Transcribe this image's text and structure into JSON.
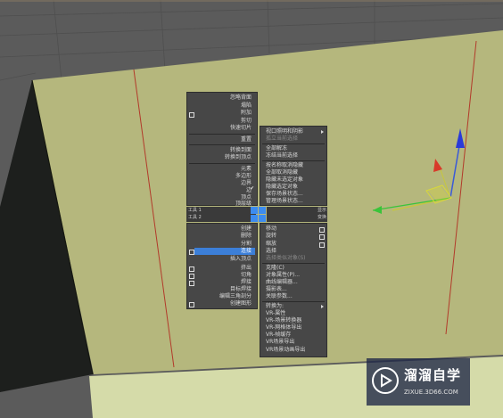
{
  "quad_left_top": [
    {
      "label": "忽略背面"
    },
    {
      "label": "塌陷"
    },
    {
      "label": "附加"
    },
    {
      "label": "剪切"
    },
    {
      "label": "快速切片"
    },
    {
      "label": "重置"
    },
    {
      "label": "转换到面"
    },
    {
      "label": "转换到顶点"
    },
    {
      "label": "元素"
    },
    {
      "label": "多边形"
    },
    {
      "label": "边界"
    },
    {
      "label": "边"
    },
    {
      "label": "顶点"
    },
    {
      "label": "顶层级"
    }
  ],
  "quad_right_top": [
    {
      "label": "视口照明和阴影"
    },
    {
      "label": "孤立当前选择"
    },
    {
      "label": "全部解冻"
    },
    {
      "label": "冻结当前选择"
    },
    {
      "label": "按名称取消隐藏"
    },
    {
      "label": "全部取消隐藏"
    },
    {
      "label": "隐藏未选定对象"
    },
    {
      "label": "隐藏选定对象"
    },
    {
      "label": "保存场景状态..."
    },
    {
      "label": "管理场景状态..."
    }
  ],
  "quad_left_bottom": [
    {
      "label": "创建"
    },
    {
      "label": "删除"
    },
    {
      "label": "分割"
    },
    {
      "label": "连接"
    },
    {
      "label": "插入顶点"
    },
    {
      "label": "挤出"
    },
    {
      "label": "切角"
    },
    {
      "label": "焊接"
    },
    {
      "label": "目标焊接"
    },
    {
      "label": "编辑三角剖分"
    },
    {
      "label": "创建图形"
    }
  ],
  "quad_right_bottom": [
    {
      "label": "移动"
    },
    {
      "label": "旋转"
    },
    {
      "label": "缩放"
    },
    {
      "label": "选择"
    },
    {
      "label": "选择类似对象(S)"
    },
    {
      "label": "克隆(C)"
    },
    {
      "label": "对象属性(P)..."
    },
    {
      "label": "曲线编辑器..."
    },
    {
      "label": "摄影表..."
    },
    {
      "label": "关联参数..."
    },
    {
      "label": "转换为:"
    },
    {
      "label": "VR-属性"
    },
    {
      "label": "VR-场景转换器"
    },
    {
      "label": "VR-网格体导出"
    },
    {
      "label": "VR-帧缓存"
    },
    {
      "label": "VR场景导出"
    },
    {
      "label": "VR场景动画导出"
    }
  ],
  "quad_headers": {
    "tool1": "工具 1",
    "tool2": "工具 2",
    "display": "显示",
    "transform": "变换"
  },
  "watermark": {
    "title": "溜溜自学",
    "url": "ZIXUE.3D66.COM"
  },
  "colors": {
    "menu_bg": "#474747",
    "highlight": "#3c7fd8",
    "plane": "#b5b77d",
    "background": "#5a5a5a"
  }
}
